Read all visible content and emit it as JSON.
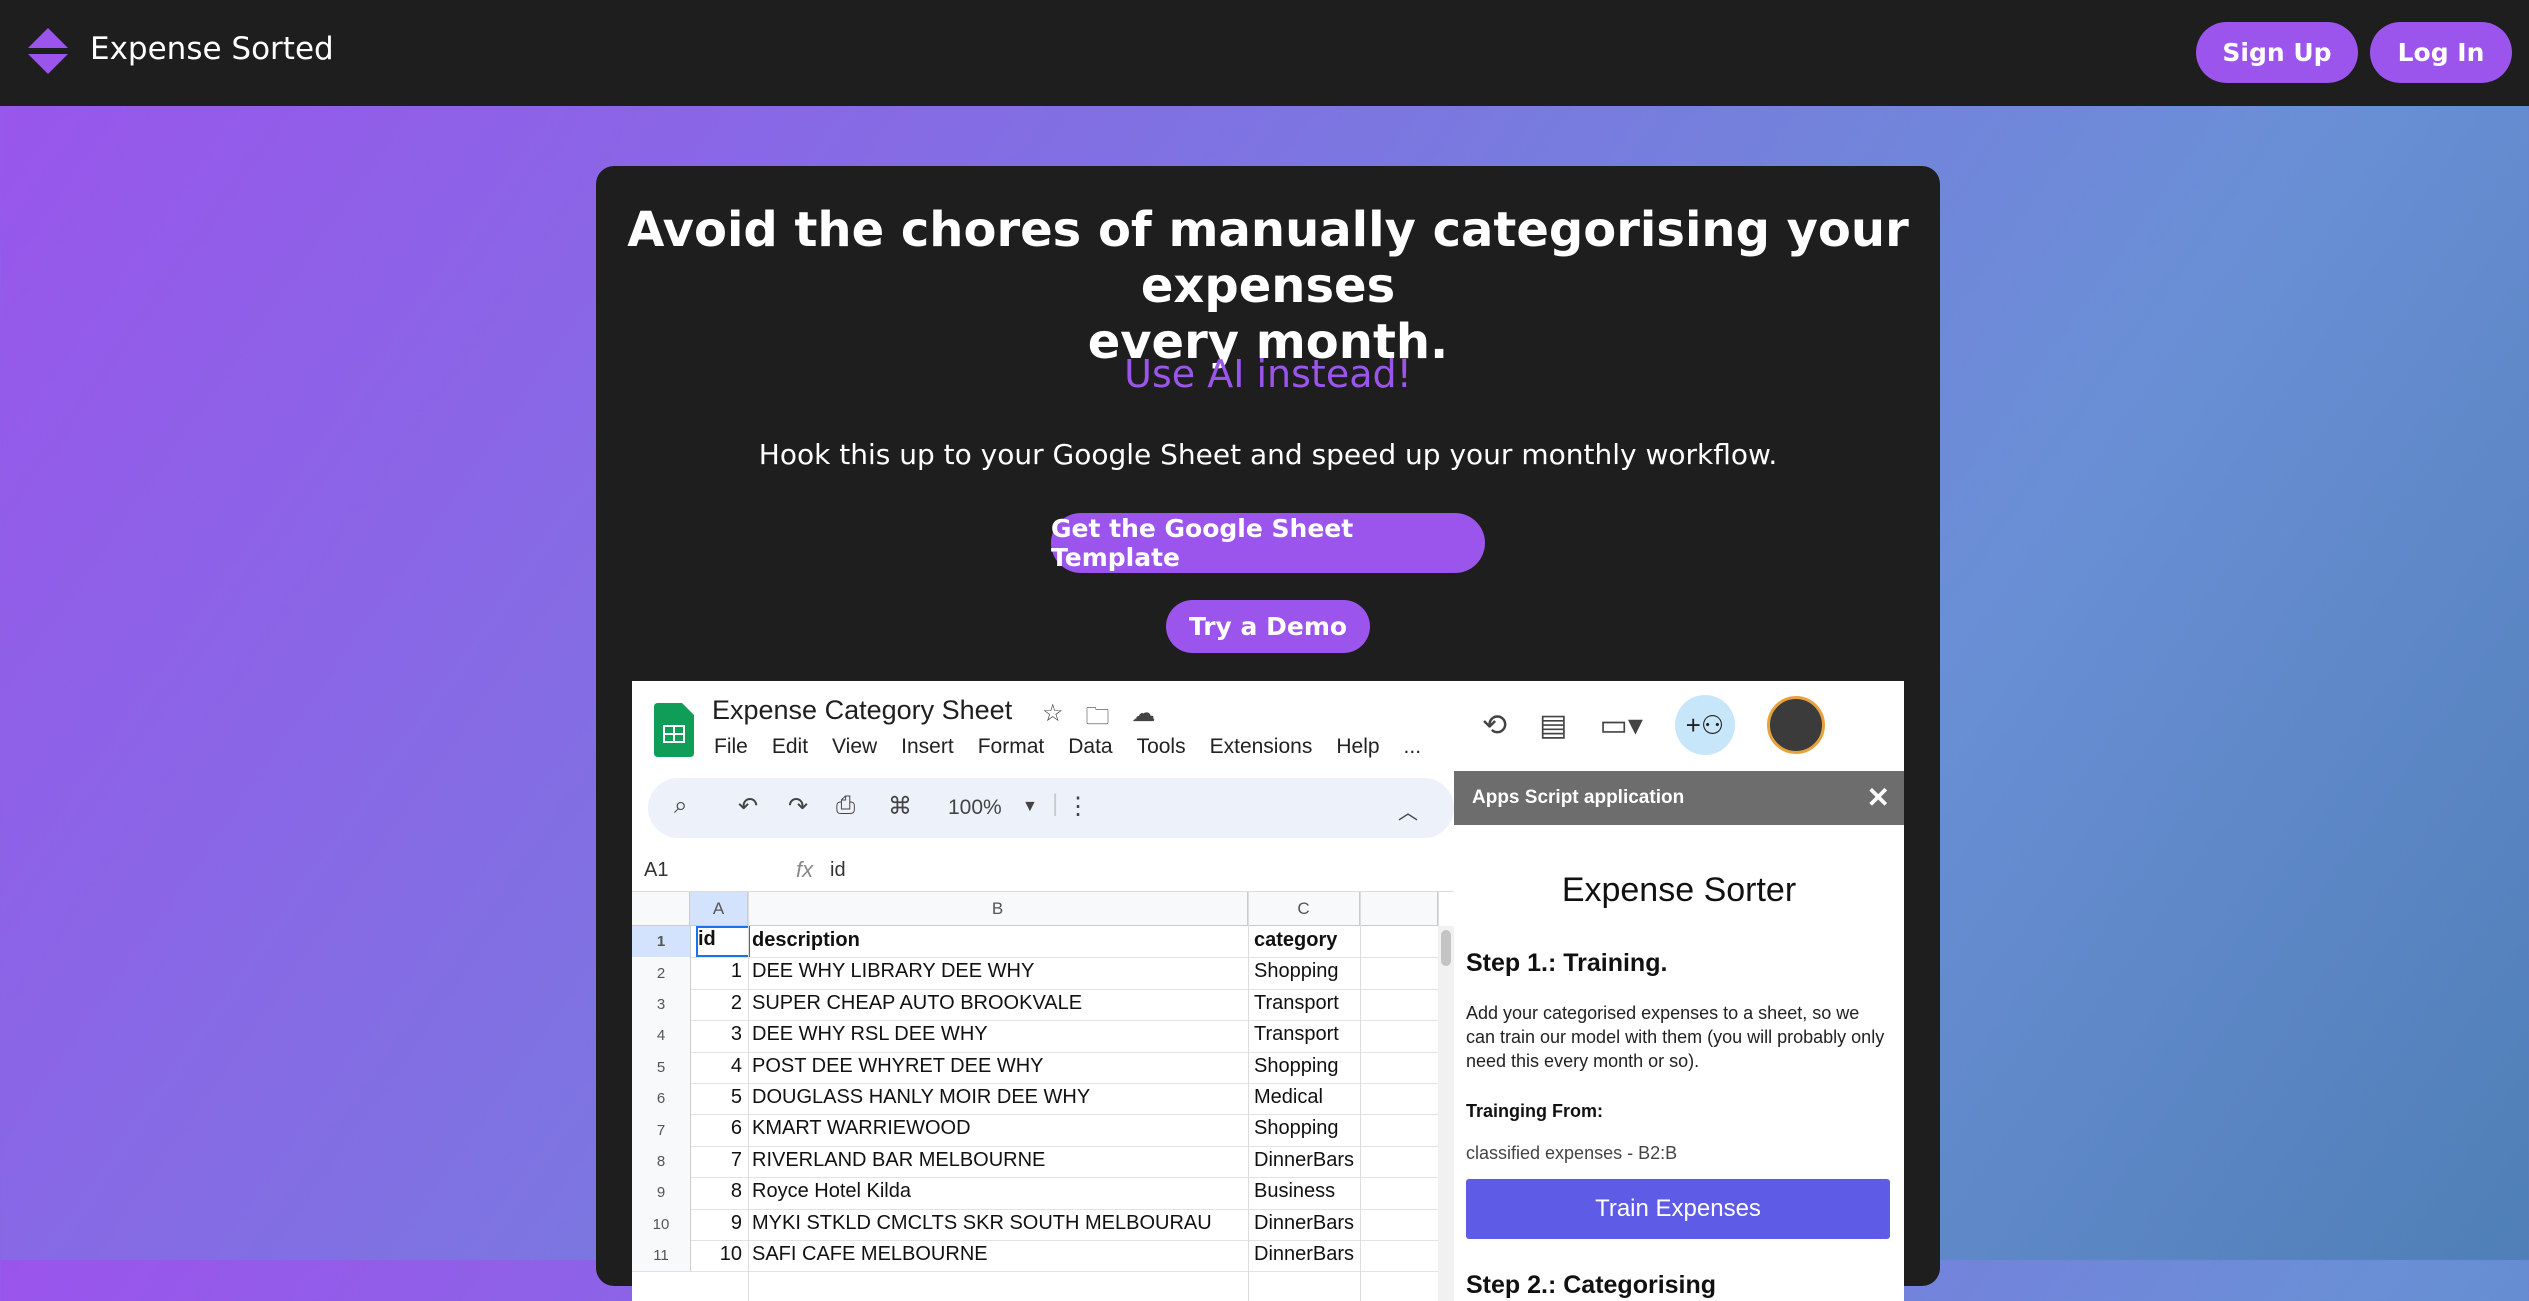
{
  "brand": {
    "name": "Expense Sorted"
  },
  "nav": {
    "signup": "Sign Up",
    "login": "Log In"
  },
  "hero": {
    "headline_line1": "Avoid the chores of manually categorising your expenses",
    "headline_line2": "every month.",
    "accent": "Use AI instead!",
    "lead": "Hook this up to your Google Sheet and speed up your monthly workflow.",
    "cta_template": "Get the Google Sheet Template",
    "cta_demo": "Try a Demo"
  },
  "sheet": {
    "title": "Expense Category Sheet",
    "menu": [
      "File",
      "Edit",
      "View",
      "Insert",
      "Format",
      "Data",
      "Tools",
      "Extensions",
      "Help",
      "..."
    ],
    "zoom": "100%",
    "cell_ref": "A1",
    "formula_value": "id",
    "col_headers": [
      "A",
      "B",
      "C"
    ],
    "header_row": {
      "rn": "1",
      "id": "id",
      "desc": "description",
      "cat": "category"
    },
    "rows": [
      {
        "rn": "2",
        "id": "1",
        "desc": "DEE WHY LIBRARY DEE WHY",
        "cat": "Shopping"
      },
      {
        "rn": "3",
        "id": "2",
        "desc": "SUPER CHEAP AUTO BROOKVALE",
        "cat": "Transport"
      },
      {
        "rn": "4",
        "id": "3",
        "desc": "DEE WHY RSL DEE WHY",
        "cat": "Transport"
      },
      {
        "rn": "5",
        "id": "4",
        "desc": "POST DEE WHYRET DEE WHY",
        "cat": "Shopping"
      },
      {
        "rn": "6",
        "id": "5",
        "desc": "DOUGLASS HANLY MOIR DEE WHY",
        "cat": "Medical"
      },
      {
        "rn": "7",
        "id": "6",
        "desc": "KMART WARRIEWOOD",
        "cat": "Shopping"
      },
      {
        "rn": "8",
        "id": "7",
        "desc": "RIVERLAND BAR MELBOURNE",
        "cat": "DinnerBars"
      },
      {
        "rn": "9",
        "id": "8",
        "desc": "Royce Hotel Kilda",
        "cat": "Business"
      },
      {
        "rn": "10",
        "id": "9",
        "desc": "MYKI STKLD CMCLTS SKR SOUTH MELBOURAU",
        "cat": "DinnerBars"
      },
      {
        "rn": "11",
        "id": "10",
        "desc": "SAFI CAFE MELBOURNE",
        "cat": "DinnerBars"
      }
    ]
  },
  "panel": {
    "header": "Apps Script application",
    "title": "Expense Sorter",
    "step1": "Step 1.: Training.",
    "step1_text": "Add your categorised expenses to a sheet, so we can train our model with them (you will probably only need this every month or so).",
    "training_label": "Trainging From:",
    "training_value": "classified expenses - B2:B",
    "train_button": "Train Expenses",
    "step2": "Step 2.: Categorising"
  }
}
